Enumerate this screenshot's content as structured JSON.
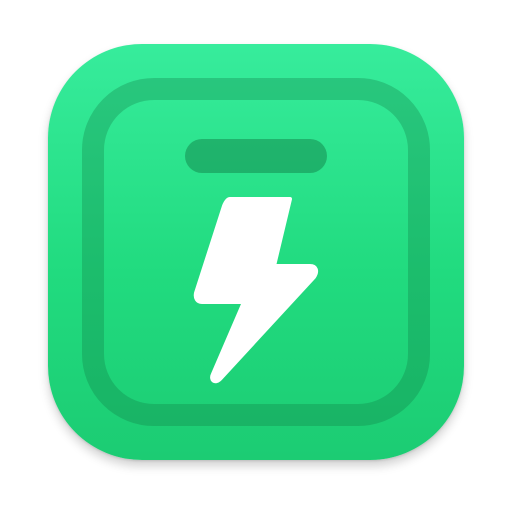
{
  "icon": {
    "name": "lightning-bolt-app-icon",
    "accent_color": "#2fe592",
    "frame_color": "#1a9a5c",
    "bolt_color": "#ffffff",
    "glyph": "lightning-icon"
  }
}
